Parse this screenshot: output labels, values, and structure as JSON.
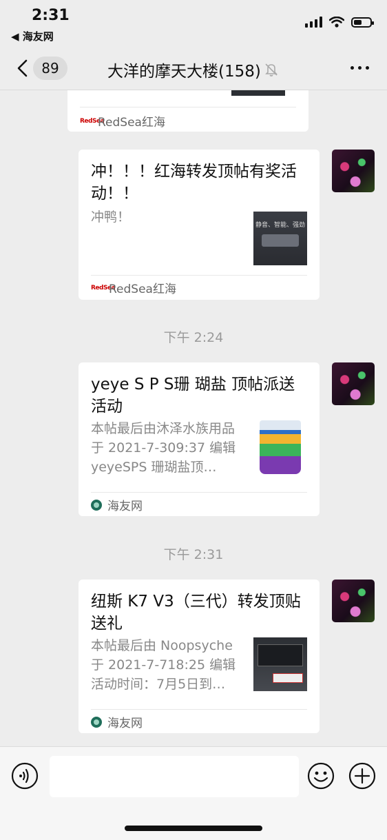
{
  "status": {
    "time": "2:31",
    "back_app": "◀ 海友网"
  },
  "nav": {
    "unread_count": "89",
    "title": "大洋的摩天大楼(158)"
  },
  "cards": [
    {
      "source": "RedSea红海"
    },
    {
      "title": "冲！！！红海转发顶帖有奖活动！！",
      "desc": "冲鸭！",
      "thumb_caption": "静音、智能、强劲",
      "source": "RedSea红海"
    },
    {
      "title": "yeye S P S珊 瑚盐 顶帖派送活动",
      "desc": "本帖最后由沐泽水族用品于 2021-7-309:37 编辑 yeyeSPS 珊瑚盐顶…",
      "source": "海友网"
    },
    {
      "title": "纽斯 K7 V3（三代）转发顶贴送礼",
      "desc": "本帖最后由 Noopsyche 于 2021-7-718:25 编辑 活动时间：7月5日到…",
      "source": "海友网"
    }
  ],
  "timestamps": [
    "下午 2:24",
    "下午 2:31"
  ],
  "colors": {
    "background": "#ededed",
    "card": "#ffffff",
    "muted_text": "#888888"
  }
}
